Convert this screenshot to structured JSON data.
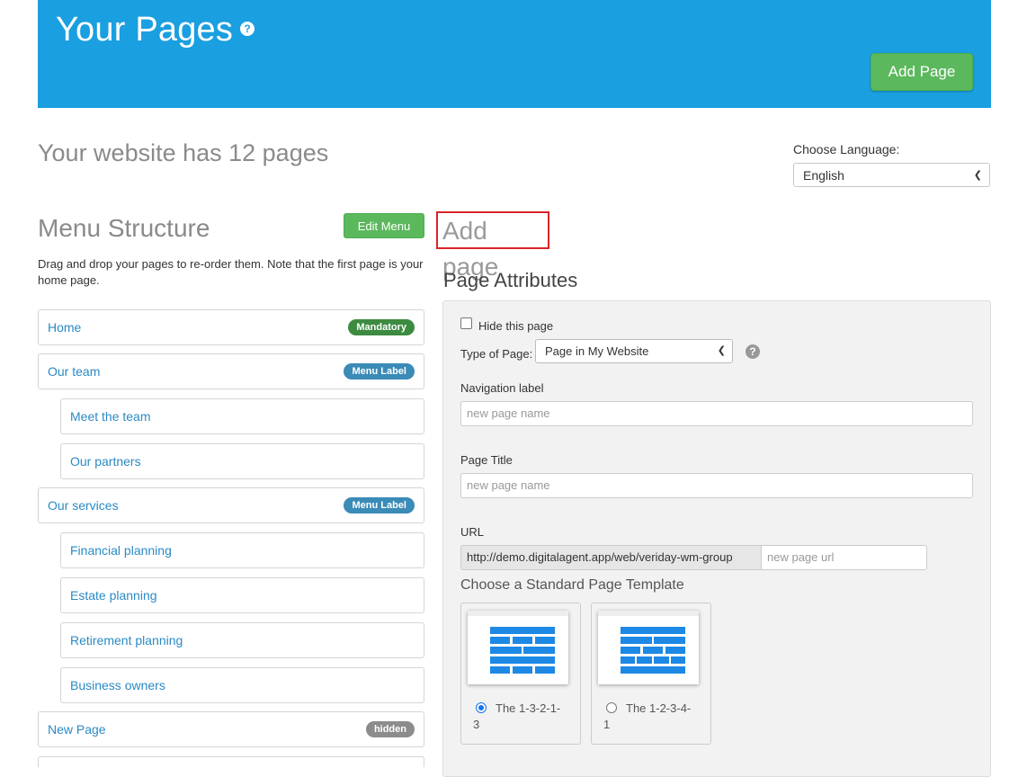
{
  "header": {
    "title": "Your Pages",
    "help_icon": "question-circle-icon",
    "add_page_label": "Add Page",
    "bg_color": "#1a9fe0"
  },
  "site": {
    "page_count_text": "Your website has 12 pages"
  },
  "language": {
    "label": "Choose Language:",
    "selected": "English"
  },
  "menu": {
    "title": "Menu Structure",
    "edit_label": "Edit Menu",
    "description": "Drag and drop your pages to re-order them. Note that the first page is your home page.",
    "items": [
      {
        "label": "Home",
        "badge": "Mandatory"
      },
      {
        "label": "Our team",
        "badge": "Menu Label"
      },
      {
        "label": "Meet the team"
      },
      {
        "label": "Our partners"
      },
      {
        "label": "Our services",
        "badge": "Menu Label"
      },
      {
        "label": "Financial planning"
      },
      {
        "label": "Estate planning"
      },
      {
        "label": "Retirement planning"
      },
      {
        "label": "Business owners"
      },
      {
        "label": "New Page",
        "badge": "hidden"
      }
    ]
  },
  "add_page": {
    "title": "Add page",
    "attributes_title": "Page Attributes",
    "hide_label": "Hide this page",
    "type_label": "Type of Page:",
    "type_selected": "Page in My Website",
    "nav_label": "Navigation label",
    "nav_placeholder": "new page name",
    "page_title_label": "Page Title",
    "page_title_placeholder": "new page name",
    "url_label": "URL",
    "url_prefix": "http://demo.digitalagent.app/web/veriday-wm-group",
    "url_placeholder": "new page url",
    "template_title": "Choose a Standard Page Template",
    "templates": [
      {
        "label_line1": "The 1-3-2-1-",
        "label_line2": "3",
        "selected": true
      },
      {
        "label_line1": "The 1-2-3-4-",
        "label_line2": "1",
        "selected": false
      }
    ]
  }
}
